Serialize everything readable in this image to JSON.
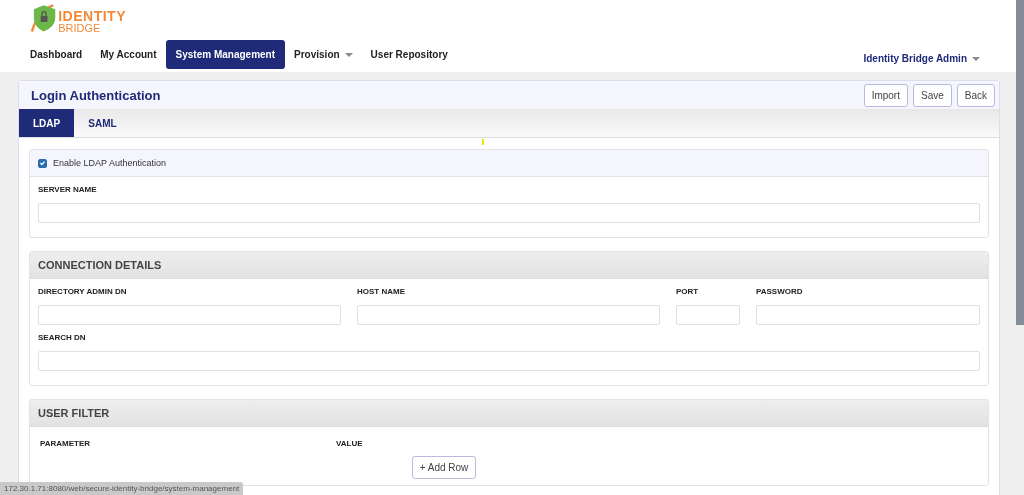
{
  "logo": {
    "line_1": "IDENTITY",
    "line_2": "BRIDGE"
  },
  "nav": [
    {
      "label": "Dashboard",
      "selected": false,
      "dropdown": false
    },
    {
      "label": "My Account",
      "selected": false,
      "dropdown": false
    },
    {
      "label": "System Management",
      "selected": true,
      "dropdown": false
    },
    {
      "label": "Provision",
      "selected": false,
      "dropdown": true
    },
    {
      "label": "User Repository",
      "selected": false,
      "dropdown": false
    }
  ],
  "user_menu": {
    "label": "Identity Bridge Admin"
  },
  "page": {
    "title": "Login Authentication",
    "actions": [
      "Import",
      "Save",
      "Back"
    ]
  },
  "tabs": [
    {
      "label": "LDAP",
      "selected": true
    },
    {
      "label": "SAML",
      "selected": false
    }
  ],
  "enable": {
    "label": "Enable LDAP Authentication",
    "checked": true
  },
  "server": {
    "label": "SERVER NAME"
  },
  "connection": {
    "title": "CONNECTION DETAILS",
    "fields": [
      {
        "label": "DIRECTORY ADMIN DN"
      },
      {
        "label": "HOST NAME"
      },
      {
        "label": "PORT"
      },
      {
        "label": "PASSWORD"
      },
      {
        "label": "SEARCH DN"
      }
    ]
  },
  "user_filter": {
    "title": "USER FILTER",
    "columns": [
      "PARAMETER",
      "VALUE"
    ],
    "add_button": "+ Add Row"
  },
  "status_url": "172.30.1.71:8080/web/secure-identity-bridge/system-management"
}
